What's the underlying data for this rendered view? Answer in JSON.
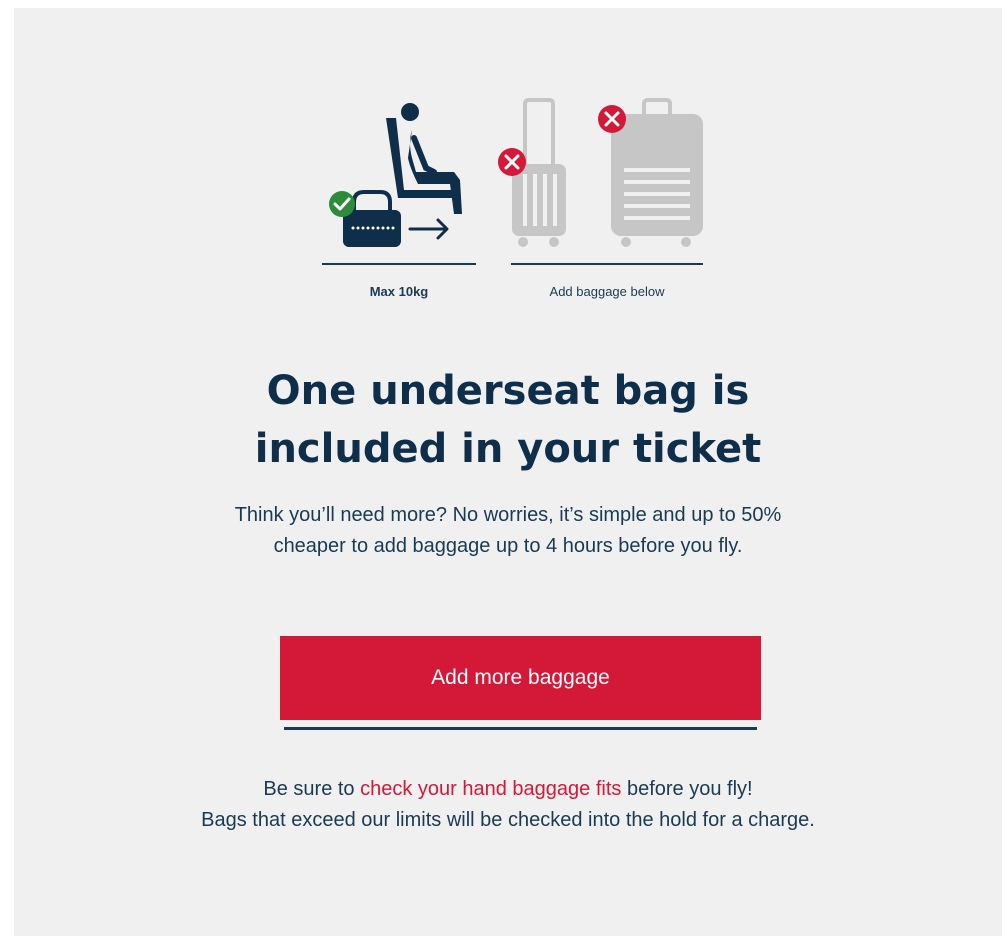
{
  "illustration": {
    "underseat_caption": "Max 10kg",
    "extra_caption": "Add baggage below",
    "icons": {
      "allowed": "check-icon",
      "not_allowed": "cross-icon",
      "seat": "seated-passenger-icon",
      "underseat_bag": "underseat-bag-icon",
      "cabin_bag": "cabin-suitcase-icon",
      "hold_bag": "hold-suitcase-icon",
      "arrow": "arrow-right-icon"
    },
    "colors": {
      "navy": "#0f2e4a",
      "green": "#2e8b3a",
      "red": "#d31838",
      "grey": "#c6c6c6"
    }
  },
  "headline": {
    "line1": "One underseat bag is",
    "line2": "included in your ticket"
  },
  "subtext": {
    "line1": "Think you’ll need more? No worries, it’s simple and up to 50%",
    "line2": "cheaper to add baggage up to 4 hours before you fly."
  },
  "cta": {
    "label": "Add more baggage",
    "color": "#d31838"
  },
  "footer": {
    "prefix": "Be sure to ",
    "link_text": "check your hand baggage fits",
    "suffix": " before you fly!",
    "line2": "Bags that exceed our limits will be checked into the hold for a charge."
  }
}
